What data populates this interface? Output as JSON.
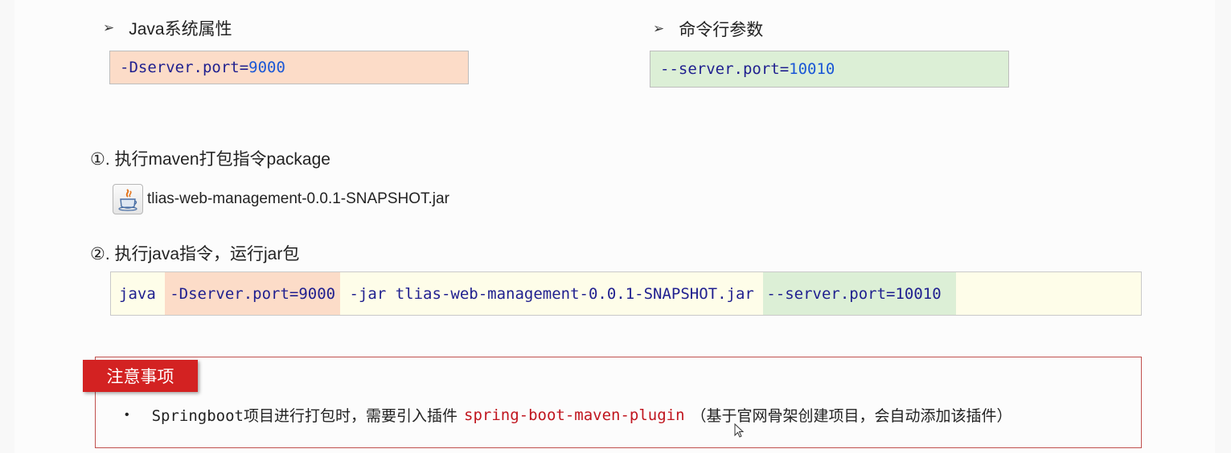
{
  "section_java": {
    "bullet": "➢",
    "title": "Java系统属性",
    "code_key": "-Dserver.port=",
    "code_value": "9000"
  },
  "section_cli": {
    "bullet": "➢",
    "title": "命令行参数",
    "code_key": "--server.port=",
    "code_value": "10010"
  },
  "step1": {
    "label": "①. 执行maven打包指令package",
    "jar_icon": "java-jar-icon",
    "jar_filename": "tlias-web-management-0.0.1-SNAPSHOT.jar"
  },
  "step2": {
    "label": "②. 执行java指令，运行jar包"
  },
  "command": {
    "java": "java ",
    "sys_prop": "-Dserver.port=9000",
    "jar_part": " -jar tlias-web-management-0.0.1-SNAPSHOT.jar ",
    "cli_arg": "--server.port=10010"
  },
  "notice": {
    "tag": "注意事项",
    "bullet": "•",
    "text_before": "Springboot项目进行打包时，需要引入插件",
    "plugin": "spring-boot-maven-plugin",
    "text_after": "（基于官网骨架创建项目，会自动添加该插件）"
  },
  "colors": {
    "orange_box": "#fcdcc8",
    "green_box": "#dcefd6",
    "cmd_bg": "#fefde9",
    "notice_red": "#d32222",
    "plugin_red": "#c0151e"
  }
}
